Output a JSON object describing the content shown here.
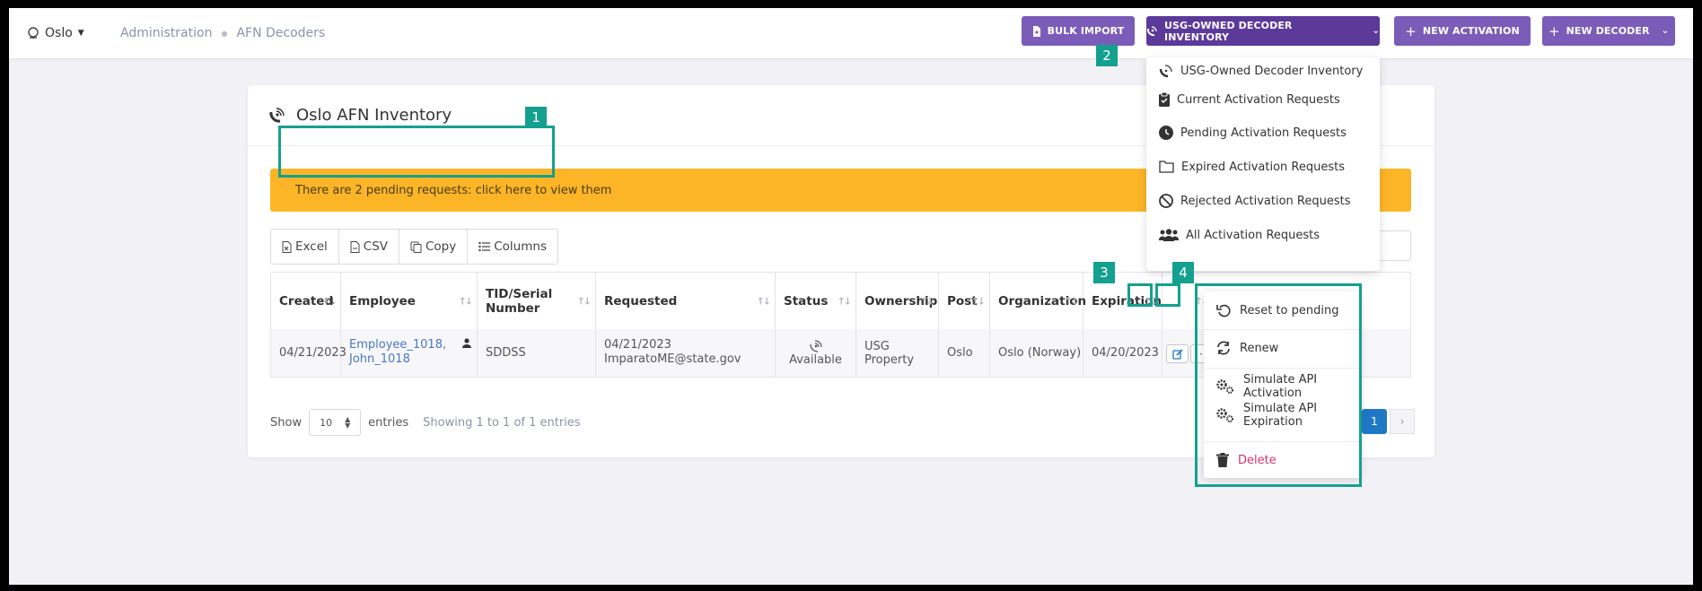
{
  "topbar": {
    "location": "Oslo",
    "breadcrumbs": [
      "Administration",
      "AFN Decoders"
    ],
    "buttons": {
      "bulk_import": "BULK IMPORT",
      "inventory": "USG-OWNED DECODER INVENTORY",
      "new_activation": "NEW ACTIVATION",
      "new_decoder": "NEW DECODER"
    }
  },
  "inventory_menu": [
    {
      "label": "USG-Owned Decoder Inventory",
      "icon": "satellite-dish-icon"
    },
    {
      "label": "Current Activation Requests",
      "icon": "clipboard-check-icon"
    },
    {
      "label": "Pending Activation Requests",
      "icon": "clock-icon"
    },
    {
      "label": "Expired Activation Requests",
      "icon": "folder-icon"
    },
    {
      "label": "Rejected Activation Requests",
      "icon": "ban-icon"
    },
    {
      "label": "All Activation Requests",
      "icon": "users-icon"
    }
  ],
  "card": {
    "title": "Oslo AFN Inventory",
    "alert": "There are 2 pending requests: click here to view them"
  },
  "export_buttons": {
    "excel": "Excel",
    "csv": "CSV",
    "copy": "Copy",
    "columns": "Columns"
  },
  "table": {
    "headers": [
      "Created",
      "Employee",
      "TID/Serial Number",
      "Requested",
      "Status",
      "Ownership",
      "Post",
      "Organization",
      "Expiration"
    ],
    "rows": [
      {
        "created": "04/21/2023",
        "employee_line1": "Employee_1018,",
        "employee_line2": "John_1018",
        "tid": "SDDSS",
        "requested_date": "04/21/2023",
        "requested_by": "ImparatoME@state.gov",
        "status": "Available",
        "ownership": "USG Property",
        "post": "Oslo",
        "organization": "Oslo (Norway)",
        "expiration": "04/20/2023"
      }
    ]
  },
  "footer": {
    "show": "Show",
    "page_size": "10",
    "entries": "entries",
    "info": "Showing 1 to 1 of 1 entries",
    "current_page": "1"
  },
  "row_menu": {
    "reset": "Reset to pending",
    "renew": "Renew",
    "sim_activation": "Simulate API Activation",
    "sim_expiration": "Simulate API Expiration",
    "delete": "Delete"
  },
  "annotations": [
    "1",
    "2",
    "3",
    "4"
  ],
  "colors": {
    "accent": "#7b5cb8",
    "alert": "#fcb527",
    "highlight": "#14a08f",
    "delete": "#d6336c",
    "link": "#4b76c2"
  }
}
